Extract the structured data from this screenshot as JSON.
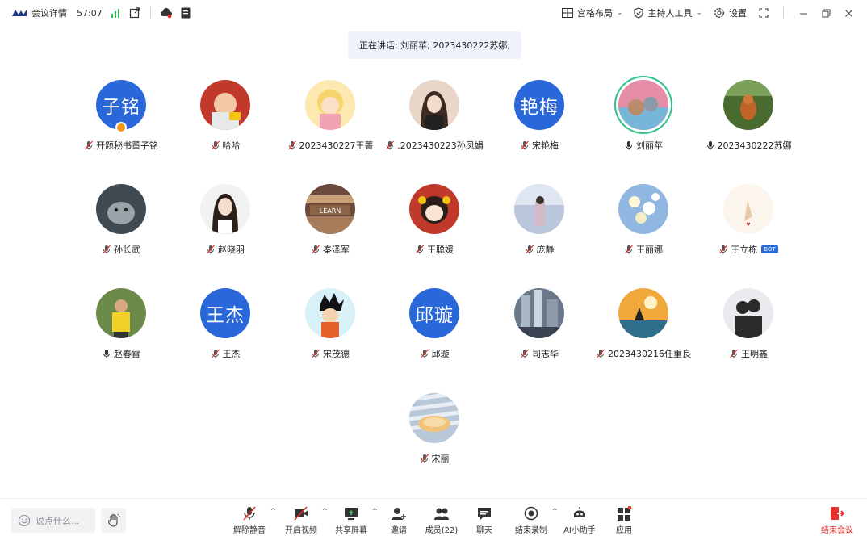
{
  "topbar": {
    "title": "会议详情",
    "timer": "57:07",
    "layout_label": "宫格布局",
    "host_tools_label": "主持人工具",
    "settings_label": "设置"
  },
  "speaking": {
    "text": "正在讲话: 刘丽苹; 2023430222苏娜;"
  },
  "participants": [
    {
      "name": "开题秘书董子铭",
      "avatar_text": "子铭",
      "mic": "muted"
    },
    {
      "name": "哈哈",
      "mic": "muted"
    },
    {
      "name": "2023430227王菁",
      "mic": "muted"
    },
    {
      "name": ".2023430223孙凤娟",
      "mic": "muted"
    },
    {
      "name": "宋艳梅",
      "avatar_text": "艳梅",
      "mic": "muted"
    },
    {
      "name": "刘丽苹",
      "mic": "on"
    },
    {
      "name": "2023430222苏娜",
      "mic": "on"
    },
    {
      "name": "孙长武",
      "mic": "muted"
    },
    {
      "name": "赵晓羽",
      "mic": "muted"
    },
    {
      "name": "秦泽军",
      "mic": "muted"
    },
    {
      "name": "王聪媛",
      "mic": "muted"
    },
    {
      "name": "庞静",
      "mic": "muted"
    },
    {
      "name": "王丽娜",
      "mic": "muted"
    },
    {
      "name": "王立栋",
      "mic": "muted",
      "badge": "BOT"
    },
    {
      "name": "赵春雷",
      "mic": "on"
    },
    {
      "name": "王杰",
      "avatar_text": "王杰",
      "mic": "muted"
    },
    {
      "name": "宋茂德",
      "mic": "muted"
    },
    {
      "name": "邱璇",
      "avatar_text": "邱璇",
      "mic": "muted"
    },
    {
      "name": "司志华",
      "mic": "muted"
    },
    {
      "name": "2023430216任重良",
      "mic": "muted"
    },
    {
      "name": "王明鑫",
      "mic": "muted"
    },
    {
      "name": "宋丽",
      "mic": "muted"
    }
  ],
  "bottombar": {
    "chat_placeholder": "说点什么...",
    "tools": [
      {
        "label": "解除静音",
        "icon": "mic-muted-icon"
      },
      {
        "label": "开启视频",
        "icon": "camera-off-icon"
      },
      {
        "label": "共享屏幕",
        "icon": "share-screen-icon"
      },
      {
        "label": "邀请",
        "icon": "invite-icon"
      },
      {
        "label": "成员(22)",
        "icon": "members-icon"
      },
      {
        "label": "聊天",
        "icon": "chat-icon"
      },
      {
        "label": "结束录制",
        "icon": "record-icon"
      },
      {
        "label": "AI小助手",
        "icon": "ai-assistant-icon"
      },
      {
        "label": "应用",
        "icon": "apps-icon"
      }
    ],
    "end_label": "结束会议"
  },
  "colors": {
    "accent": "#2a67d9",
    "danger": "#e4322b",
    "active_ring": "#2fbf8a"
  }
}
